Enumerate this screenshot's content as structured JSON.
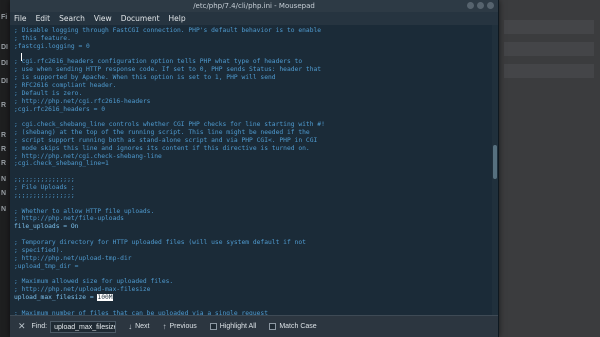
{
  "desktop": {
    "left_letters": [
      "Fi",
      "DI",
      "DI",
      "DI",
      "R",
      "R",
      "R",
      "R",
      "N",
      "N",
      "N"
    ]
  },
  "window": {
    "title": "/etc/php/7.4/cli/php.ini - Mousepad"
  },
  "menubar": {
    "items": [
      "File",
      "Edit",
      "Search",
      "View",
      "Document",
      "Help"
    ]
  },
  "editor": {
    "lines": [
      {
        "text": "; Disable logging through FastCGI connection. PHP's default behavior is to enable",
        "kind": "comment"
      },
      {
        "text": "; this feature.",
        "kind": "comment"
      },
      {
        "text": ";fastcgi.logging = 0",
        "kind": "comment"
      },
      {
        "text": "",
        "kind": "blank"
      },
      {
        "text": "; cgi.rfc2616_headers configuration option tells PHP what type of headers to",
        "kind": "comment"
      },
      {
        "text": "; use when sending HTTP response code. If set to 0, PHP sends Status: header that",
        "kind": "comment"
      },
      {
        "text": "; is supported by Apache. When this option is set to 1, PHP will send",
        "kind": "comment"
      },
      {
        "text": "; RFC2616 compliant header.",
        "kind": "comment"
      },
      {
        "text": "; Default is zero.",
        "kind": "comment"
      },
      {
        "text": "; http://php.net/cgi.rfc2616-headers",
        "kind": "comment"
      },
      {
        "text": ";cgi.rfc2616_headers = 0",
        "kind": "comment"
      },
      {
        "text": "",
        "kind": "blank"
      },
      {
        "text": "; cgi.check_shebang_line controls whether CGI PHP checks for line starting with #!",
        "kind": "comment"
      },
      {
        "text": "; (shebang) at the top of the running script. This line might be needed if the",
        "kind": "comment"
      },
      {
        "text": "; script support running both as stand-alone script and via PHP CGI<. PHP in CGI",
        "kind": "comment"
      },
      {
        "text": "; mode skips this line and ignores its content if this directive is turned on.",
        "kind": "comment"
      },
      {
        "text": "; http://php.net/cgi.check-shebang-line",
        "kind": "comment"
      },
      {
        "text": ";cgi.check_shebang_line=1",
        "kind": "comment"
      },
      {
        "text": "",
        "kind": "blank"
      },
      {
        "text": ";;;;;;;;;;;;;;;;",
        "kind": "comment"
      },
      {
        "text": "; File Uploads ;",
        "kind": "comment"
      },
      {
        "text": ";;;;;;;;;;;;;;;;",
        "kind": "comment"
      },
      {
        "text": "",
        "kind": "blank"
      },
      {
        "text": "; Whether to allow HTTP file uploads.",
        "kind": "comment"
      },
      {
        "text": "; http://php.net/file-uploads",
        "kind": "comment"
      },
      {
        "text": "file_uploads = On",
        "kind": "setting"
      },
      {
        "text": "",
        "kind": "blank"
      },
      {
        "text": "; Temporary directory for HTTP uploaded files (will use system default if not",
        "kind": "comment"
      },
      {
        "text": "; specified).",
        "kind": "comment"
      },
      {
        "text": "; http://php.net/upload-tmp-dir",
        "kind": "comment"
      },
      {
        "text": ";upload_tmp_dir =",
        "kind": "comment"
      },
      {
        "text": "",
        "kind": "blank"
      },
      {
        "text": "; Maximum allowed size for uploaded files.",
        "kind": "comment"
      },
      {
        "text": "; http://php.net/upload-max-filesize",
        "kind": "comment"
      },
      {
        "text": "upload_max_filesize = ",
        "kind": "setting",
        "highlight": "100M"
      },
      {
        "text": "",
        "kind": "blank"
      },
      {
        "text": "; Maximum number of files that can be uploaded via a single request",
        "kind": "comment"
      }
    ]
  },
  "findbar": {
    "label": "Find:",
    "query": "upload_max_filesize",
    "next_label": "Next",
    "previous_label": "Previous",
    "highlight_all_label": "Highlight All",
    "match_case_label": "Match Case"
  }
}
